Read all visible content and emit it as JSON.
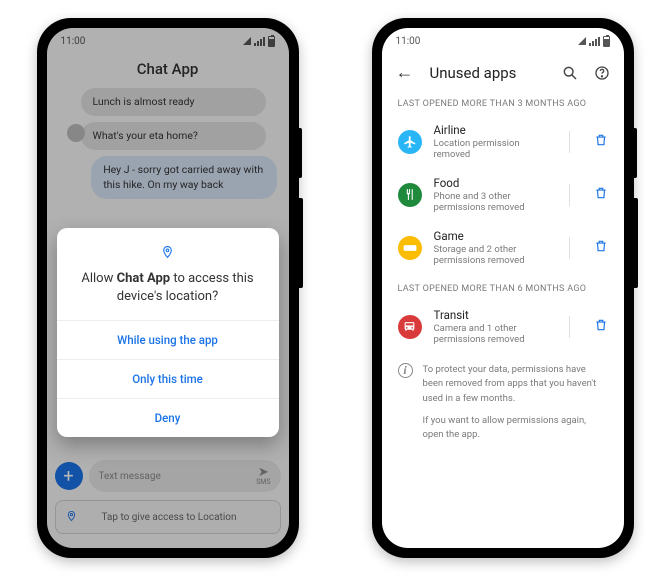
{
  "left": {
    "status_time": "11:00",
    "header": "Chat App",
    "messages": {
      "m1": "Lunch is almost ready",
      "m2": "What's your eta home?",
      "m3": "Hey J - sorry got carried away with this hike. On my way back"
    },
    "dialog": {
      "title_pre": "Allow ",
      "app": "Chat App",
      "title_post": " to access this device's location?",
      "opt1": "While using the app",
      "opt2": "Only this time",
      "opt3": "Deny"
    },
    "compose_placeholder": "Text message",
    "compose_send_label": "SMS",
    "location_banner": "Tap to give access to Location"
  },
  "right": {
    "status_time": "11:00",
    "title": "Unused apps",
    "section1": "LAST OPENED MORE THAN 3 MONTHS AGO",
    "section2": "LAST OPENED MORE THAN 6 MONTHS AGO",
    "apps": {
      "a1": {
        "name": "Airline",
        "sub": "Location permission removed",
        "color": "#29b6f6"
      },
      "a2": {
        "name": "Food",
        "sub": "Phone and 3 other permissions removed",
        "color": "#1f8a3b"
      },
      "a3": {
        "name": "Game",
        "sub": "Storage and 2 other permissions removed",
        "color": "#fbbc04"
      },
      "a4": {
        "name": "Transit",
        "sub": "Camera and 1 other permissions removed",
        "color": "#d93a3a"
      }
    },
    "info1": "To protect your data, permissions have been removed from  apps that you haven't used in a few months.",
    "info2": "If you want to allow permissions again, open the app."
  }
}
